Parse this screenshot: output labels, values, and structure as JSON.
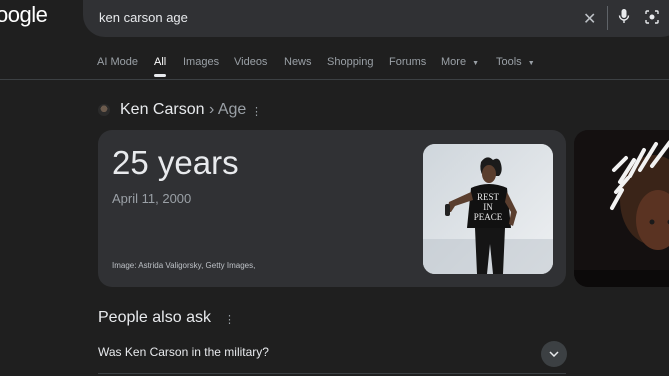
{
  "header": {
    "logo_text": "oogle",
    "search": {
      "query": "ken carson age"
    },
    "icons": {
      "clear": "close-icon",
      "voice": "mic-icon",
      "lens": "lens-icon"
    }
  },
  "tabs": [
    {
      "label": "AI Mode",
      "active": false
    },
    {
      "label": "All",
      "active": true
    },
    {
      "label": "Images",
      "active": false
    },
    {
      "label": "Videos",
      "active": false
    },
    {
      "label": "News",
      "active": false
    },
    {
      "label": "Shopping",
      "active": false
    },
    {
      "label": "Forums",
      "active": false
    },
    {
      "label": "More",
      "active": false,
      "has_dropdown": true
    },
    {
      "label": "Tools",
      "active": false,
      "has_dropdown": true
    }
  ],
  "knowledge": {
    "entity": "Ken Carson",
    "separator": " › ",
    "attribute": "Age",
    "age": "25 years",
    "birthdate": "April 11, 2000",
    "image_credit": "Image: Astrida Valigorsky, Getty Images,",
    "photo_shirt_text": [
      "REST",
      "IN",
      "PEACE"
    ]
  },
  "people_also_ask": {
    "title": "People also ask",
    "questions": [
      "Was Ken Carson in the military?"
    ]
  },
  "colors": {
    "background": "#1f1f1f",
    "surface": "#303134",
    "text": "#e8eaed",
    "muted": "#9aa0a6"
  }
}
